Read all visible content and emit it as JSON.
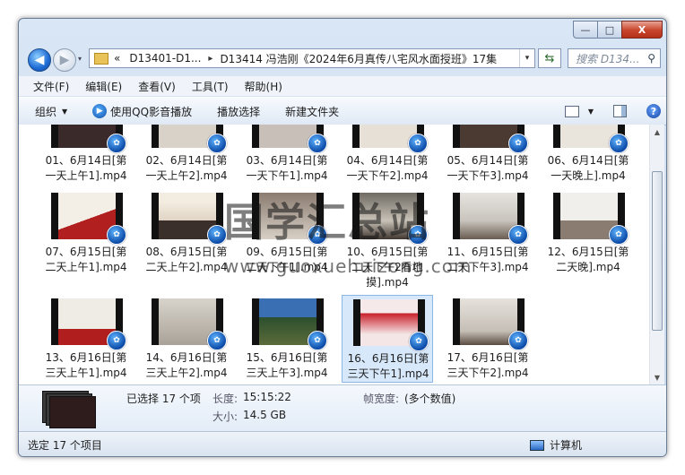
{
  "window": {
    "controls": {
      "minimize": "—",
      "maximize": "□",
      "close": "X"
    }
  },
  "address": {
    "history_glyph": "▾",
    "overflow": "«",
    "crumbs": [
      "D13401-D1...",
      "D13414 冯浩刚《2024年6月真传八宅风水面授班》17集"
    ],
    "separator": "▸",
    "dropdown": "▾",
    "refresh": "⇆",
    "search_placeholder": "搜索 D134...",
    "search_icon": "⚲"
  },
  "menu": [
    "文件(F)",
    "编辑(E)",
    "查看(V)",
    "工具(T)",
    "帮助(H)"
  ],
  "toolbar": {
    "organize": "组织",
    "play_qq": "使用QQ影音播放",
    "play_selection": "播放选择",
    "new_folder": "新建文件夹",
    "dropdown_glyph": "▼",
    "help_glyph": "?"
  },
  "files": [
    {
      "name": "01、6月14日[第一天上午1].mp4",
      "l1": "01、6月14日[第",
      "l2": "一天上午1].mp4"
    },
    {
      "name": "02、6月14日[第一天上午2].mp4",
      "l1": "02、6月14日[第",
      "l2": "一天上午2].mp4"
    },
    {
      "name": "03、6月14日[第一天下午1].mp4",
      "l1": "03、6月14日[第",
      "l2": "一天下午1].mp4"
    },
    {
      "name": "04、6月14日[第一天下午2].mp4",
      "l1": "04、6月14日[第",
      "l2": "一天下午2].mp4"
    },
    {
      "name": "05、6月14日[第一天下午3].mp4",
      "l1": "05、6月14日[第",
      "l2": "一天下午3].mp4"
    },
    {
      "name": "06、6月14日[第一天晚上].mp4",
      "l1": "06、6月14日[第",
      "l2": "一天晚上].mp4"
    },
    {
      "name": "07、6月15日[第二天上午1].mp4",
      "l1": "07、6月15日[第",
      "l2": "二天上午1].mp4"
    },
    {
      "name": "08、6月15日[第二天上午2].mp4",
      "l1": "08、6月15日[第",
      "l2": "二天上午2].mp4"
    },
    {
      "name": "09、6月15日[第二天下午1].mp4",
      "l1": "09、6月15日[第",
      "l2": "二天下午1].mp4"
    },
    {
      "name": "10、6月15日[第二天下午2看地].mp4",
      "l1": "10、6月15日[第",
      "l2": "二天下午2看地",
      "l3": "摸].mp4"
    },
    {
      "name": "11、6月15日[第二天下午3].mp4",
      "l1": "11、6月15日[第",
      "l2": "二天下午3].mp4"
    },
    {
      "name": "12、6月15日[第二天晚].mp4",
      "l1": "12、6月15日[第",
      "l2": "二天晚].mp4"
    },
    {
      "name": "13、6月16日[第三天上午1].mp4",
      "l1": "13、6月16日[第",
      "l2": "三天上午1].mp4"
    },
    {
      "name": "14、6月16日[第三天上午2].mp4",
      "l1": "14、6月16日[第",
      "l2": "三天上午2].mp4"
    },
    {
      "name": "15、6月16日[第三天上午3].mp4",
      "l1": "15、6月16日[第",
      "l2": "三天上午3].mp4"
    },
    {
      "name": "16、6月16日[第三天下午1].mp4",
      "l1": "16、6月16日[第",
      "l2": "三天下午1].mp4"
    },
    {
      "name": "17、6月16日[第三天下午2].mp4",
      "l1": "17、6月16日[第",
      "l2": "三天下午2].mp4"
    }
  ],
  "watermark": {
    "title": "国学汇总站",
    "url": "www.guoxuehuizong.com"
  },
  "details": {
    "selected": "已选择 17 个项",
    "length_label": "长度:",
    "length_value": "15:15:22",
    "size_label": "大小:",
    "size_value": "14.5 GB",
    "frame_label": "帧宽度:",
    "frame_value": "(多个数值)"
  },
  "status": {
    "left": "选定 17 个项目",
    "right": "计算机"
  },
  "badge_glyph": "✿",
  "colors": {
    "selection": "#d7e8fb",
    "accent": "#1d6ad4",
    "close": "#c8442c"
  }
}
